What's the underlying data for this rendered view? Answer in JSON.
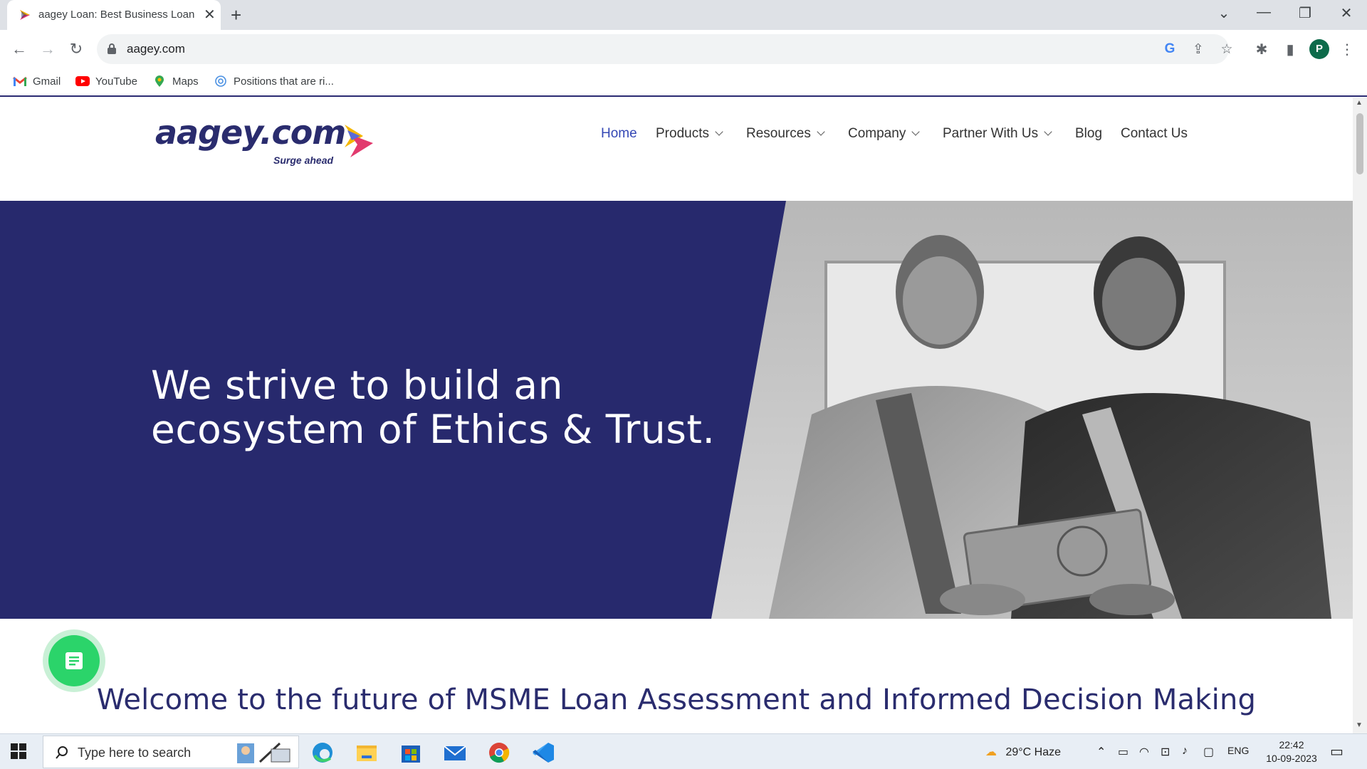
{
  "browser": {
    "tab_title": "aagey Loan: Best Business Loans",
    "url": "aagey.com",
    "profile_initial": "P",
    "bookmarks": [
      {
        "label": "Gmail",
        "icon": "gmail-icon"
      },
      {
        "label": "YouTube",
        "icon": "youtube-icon"
      },
      {
        "label": "Maps",
        "icon": "maps-icon"
      },
      {
        "label": "Positions that are ri...",
        "icon": "globe-icon"
      }
    ]
  },
  "site": {
    "logo_text": "aagey.com",
    "logo_tagline": "Surge ahead",
    "nav": [
      {
        "label": "Home",
        "active": true,
        "dropdown": false
      },
      {
        "label": "Products",
        "dropdown": true
      },
      {
        "label": "Resources",
        "dropdown": true
      },
      {
        "label": "Company",
        "dropdown": true
      },
      {
        "label": "Partner With Us",
        "dropdown": true
      },
      {
        "label": "Blog",
        "dropdown": false
      },
      {
        "label": "Contact Us",
        "dropdown": false
      }
    ],
    "hero_heading": "We strive to build an ecosystem of Ethics & Trust.",
    "welcome_heading": "Welcome to the future of MSME Loan Assessment and Informed Decision Making",
    "colors": {
      "brand_navy": "#27296d",
      "nav_active": "#3548b5",
      "chat_green": "#2bd46a"
    }
  },
  "taskbar": {
    "search_placeholder": "Type here to search",
    "weather": "29°C  Haze",
    "language": "ENG",
    "time": "22:42",
    "date": "10-09-2023"
  }
}
